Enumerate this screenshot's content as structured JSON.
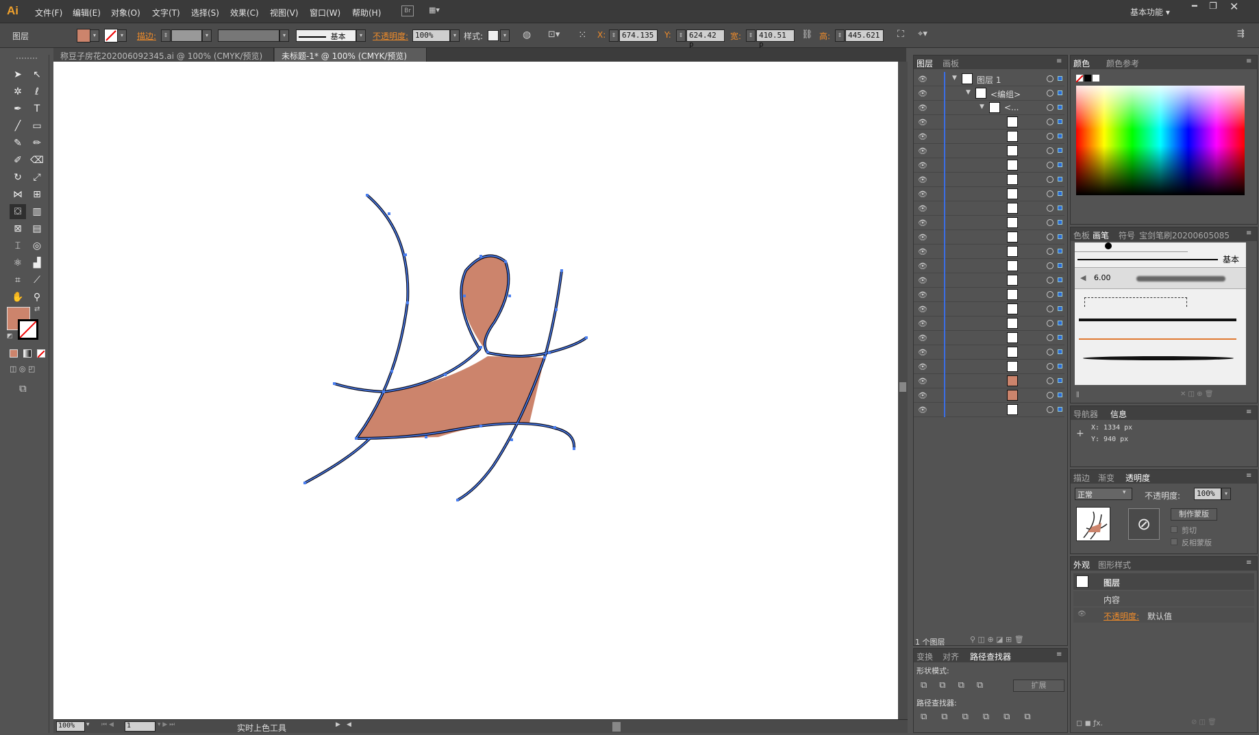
{
  "app": {
    "logo": "Ai",
    "workspace": "基本功能"
  },
  "menu": [
    "文件(F)",
    "编辑(E)",
    "对象(O)",
    "文字(T)",
    "选择(S)",
    "效果(C)",
    "视图(V)",
    "窗口(W)",
    "帮助(H)"
  ],
  "control": {
    "selection_label": "图层",
    "stroke_label": "描边:",
    "brush_label": "基本",
    "opacity_label": "不透明度:",
    "opacity_value": "100%",
    "style_label": "样式:",
    "x_label": "X:",
    "x_value": "674.135",
    "y_label": "Y:",
    "y_value": "624.42 p",
    "w_label": "宽:",
    "w_value": "410.51 p",
    "h_label": "高:",
    "h_value": "445.621"
  },
  "colors": {
    "fill": "#cc846c",
    "accent": "#f08c2a",
    "selection": "#3a6ee8"
  },
  "doc_tabs": [
    {
      "label": "称豆子房花202006092345.ai @ 100% (CMYK/预览)",
      "active": false
    },
    {
      "label": "未标题-1* @ 100% (CMYK/预览)",
      "active": true
    }
  ],
  "status": {
    "zoom": "100%",
    "page": "1",
    "tool": "实时上色工具"
  },
  "layers_panel": {
    "tabs": [
      "图层",
      "画板"
    ],
    "rows": [
      "图层 1",
      "<编组>",
      "<..."
    ],
    "footer": "1 个图层",
    "row_count": 24
  },
  "color_panel": {
    "tabs": [
      "颜色",
      "颜色参考"
    ]
  },
  "brush_panel": {
    "tabs": [
      "色板",
      "画笔",
      "符号",
      "宝剑笔刷20200605085"
    ],
    "basic_label": "基本",
    "size": "6.00"
  },
  "info_panel": {
    "tabs": [
      "导航器",
      "信息"
    ],
    "x": "X: 1334 px",
    "y": "Y: 940 px"
  },
  "transparency_panel": {
    "tabs": [
      "描边",
      "渐变",
      "透明度"
    ],
    "mode": "正常",
    "opacity_label": "不透明度:",
    "opacity_value": "100%",
    "make_mask": "制作蒙版",
    "clip": "剪切",
    "invert": "反相蒙版"
  },
  "appearance_panel": {
    "tabs": [
      "外观",
      "图形样式"
    ],
    "title": "图层",
    "content": "内容",
    "opacity_label": "不透明度:",
    "opacity_value": "默认值"
  },
  "pathfinder_panel": {
    "tabs": [
      "变换",
      "对齐",
      "路径查找器"
    ],
    "shape_modes": "形状模式:",
    "expand": "扩展",
    "pathfinders": "路径查找器:"
  }
}
